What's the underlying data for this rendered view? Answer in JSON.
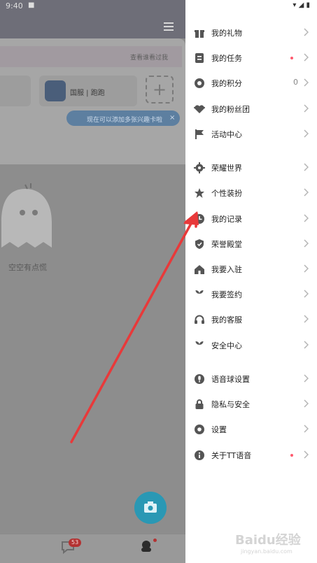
{
  "status_bar": {
    "time": "9:40",
    "notification_glyph": "■"
  },
  "background_app": {
    "strip_text": "查看谁看过我",
    "game_name": "国服 | 跑跑",
    "add_symbol": "+",
    "tip_text": "现在可以添加多张兴趣卡啦",
    "tip_close": "×",
    "empty_text": "空空有点慌",
    "chat_badge": "53"
  },
  "menu": {
    "items": [
      {
        "label": "我的礼物",
        "icon": "gift-icon"
      },
      {
        "label": "我的任务",
        "icon": "task-icon",
        "has_dot": true
      },
      {
        "label": "我的积分",
        "icon": "points-icon",
        "value": "0"
      },
      {
        "label": "我的粉丝团",
        "icon": "fans-icon"
      },
      {
        "label": "活动中心",
        "icon": "flag-icon"
      },
      {
        "label": "荣耀世界",
        "icon": "glory-icon"
      },
      {
        "label": "个性装扮",
        "icon": "dress-up-icon"
      },
      {
        "label": "我的记录",
        "icon": "record-icon"
      },
      {
        "label": "荣誉殿堂",
        "icon": "shield-icon"
      },
      {
        "label": "我要入驻",
        "icon": "home-icon"
      },
      {
        "label": "我要签约",
        "icon": "sign-icon"
      },
      {
        "label": "我的客服",
        "icon": "headset-icon"
      },
      {
        "label": "安全中心",
        "icon": "security-icon"
      },
      {
        "label": "语音球设置",
        "icon": "mic-icon"
      },
      {
        "label": "隐私与安全",
        "icon": "lock-icon"
      },
      {
        "label": "设置",
        "icon": "gear-icon"
      },
      {
        "label": "关于TT语音",
        "icon": "info-icon",
        "has_dot": true
      }
    ]
  },
  "watermark": {
    "brand": "Baidu经验",
    "url": "jingyan.baidu.com"
  },
  "colors": {
    "menu_icon": "#555555",
    "badge_dot": "#ff5a6e",
    "arrow": "#e8393a",
    "camera_button": "#2a98b4"
  }
}
